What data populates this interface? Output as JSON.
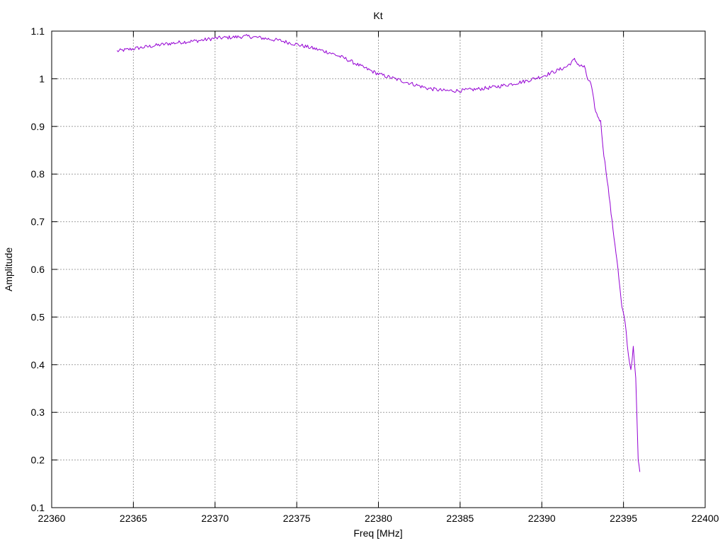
{
  "chart_data": {
    "type": "line",
    "title": "Kt",
    "xlabel": "Freq [MHz]",
    "ylabel": "Amplitude",
    "xlim": [
      22360,
      22400
    ],
    "ylim": [
      0.1,
      1.1
    ],
    "x_ticks": [
      "22360",
      "22365",
      "22370",
      "22375",
      "22380",
      "22385",
      "22390",
      "22395",
      "22400"
    ],
    "y_ticks": [
      "0.1",
      "0.2",
      "0.3",
      "0.4",
      "0.5",
      "0.6",
      "0.7",
      "0.8",
      "0.9",
      "1",
      "1.1"
    ],
    "grid": true,
    "legend": "none",
    "series": [
      {
        "color": "#9400d3",
        "x": [
          22364.0,
          22365,
          22366,
          22367,
          22368,
          22369,
          22370,
          22371,
          22372,
          22373,
          22374,
          22375,
          22376,
          22377,
          22378,
          22379,
          22380,
          22381,
          22382,
          22383,
          22384,
          22385,
          22386,
          22387,
          22388,
          22389,
          22390,
          22391,
          22391.5,
          22392,
          22392.3,
          22392.6,
          22392.8,
          22393.0,
          22393.3,
          22393.6,
          22393.8,
          22394.0,
          22394.3,
          22394.6,
          22394.9,
          22395.1,
          22395.3,
          22395.45,
          22395.6,
          22395.75,
          22395.9,
          22396.0
        ],
        "y": [
          1.058,
          1.063,
          1.068,
          1.073,
          1.077,
          1.08,
          1.085,
          1.087,
          1.089,
          1.085,
          1.08,
          1.072,
          1.064,
          1.055,
          1.042,
          1.025,
          1.01,
          1.0,
          0.99,
          0.98,
          0.975,
          0.975,
          0.978,
          0.982,
          0.988,
          0.995,
          1.005,
          1.018,
          1.025,
          1.04,
          1.028,
          1.025,
          1.0,
          0.99,
          0.93,
          0.91,
          0.84,
          0.79,
          0.7,
          0.62,
          0.52,
          0.49,
          0.42,
          0.39,
          0.435,
          0.37,
          0.2,
          0.175
        ]
      }
    ]
  }
}
